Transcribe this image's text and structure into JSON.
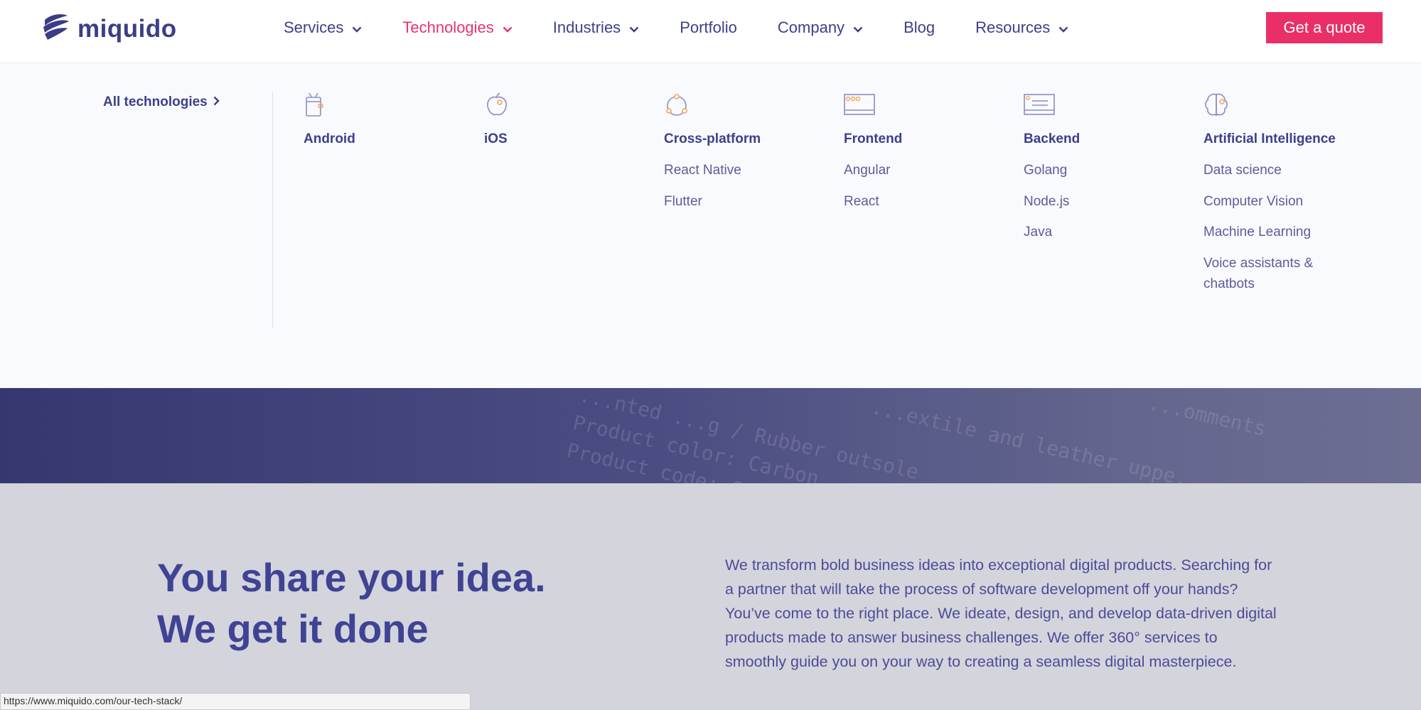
{
  "brand": {
    "name": "miquido"
  },
  "nav": {
    "items": [
      {
        "label": "Services",
        "has_dropdown": true,
        "active": false
      },
      {
        "label": "Technologies",
        "has_dropdown": true,
        "active": true
      },
      {
        "label": "Industries",
        "has_dropdown": true,
        "active": false
      },
      {
        "label": "Portfolio",
        "has_dropdown": false,
        "active": false
      },
      {
        "label": "Company",
        "has_dropdown": true,
        "active": false
      },
      {
        "label": "Blog",
        "has_dropdown": false,
        "active": false
      },
      {
        "label": "Resources",
        "has_dropdown": true,
        "active": false
      }
    ],
    "quote_button": "Get a quote"
  },
  "mega_menu": {
    "all_link": "All technologies",
    "columns": [
      {
        "title": "Android",
        "icon": "android-icon",
        "links": []
      },
      {
        "title": "iOS",
        "icon": "apple-icon",
        "links": []
      },
      {
        "title": "Cross-platform",
        "icon": "cross-platform-icon",
        "links": [
          "React Native",
          "Flutter"
        ]
      },
      {
        "title": "Frontend",
        "icon": "browser-window-icon",
        "links": [
          "Angular",
          "React"
        ]
      },
      {
        "title": "Backend",
        "icon": "server-window-icon",
        "links": [
          "Golang",
          "Node.js",
          "Java"
        ]
      },
      {
        "title": "Artificial Intelligence",
        "icon": "brain-icon",
        "links": [
          "Data science",
          "Computer Vision",
          "Machine Learning",
          "Voice assistants & chatbots"
        ]
      }
    ]
  },
  "band": {
    "text_lines": [
      "...nted        ...g / Rubber outsole",
      "Product color: Carbon ...",
      "Product code: CO..."
    ],
    "fragments": [
      "...extile and leather uppe...",
      "...omments"
    ]
  },
  "hero": {
    "headline_line1": "You share your idea.",
    "headline_line2": "We get it done",
    "description": "We transform bold business ideas into exceptional digital products. Searching for a partner that will take the process of software development off your hands? You’ve come to the right place. We ideate, design, and develop data-driven digital products made to answer business challenges. We offer 360° services to smoothly guide you on your way to creating a seamless digital masterpiece."
  },
  "status_bar": {
    "url": "https://www.miquido.com/our-tech-stack/"
  },
  "colors": {
    "brand_navy": "#3d3f8a",
    "accent_pink": "#e7336b",
    "icon_orange": "#f2a65a"
  }
}
